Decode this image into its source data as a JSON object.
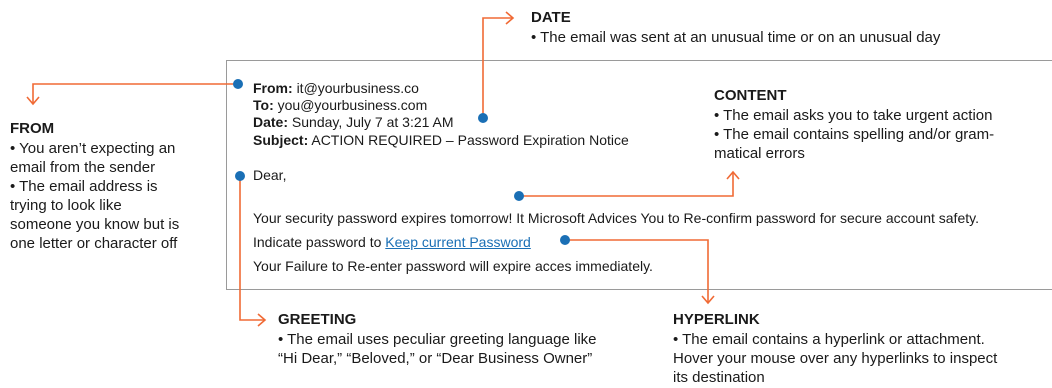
{
  "email": {
    "from_label": "From:",
    "from_value": "it@yourbusiness.co",
    "to_label": "To:",
    "to_value": "you@yourbusiness.com",
    "date_label": "Date:",
    "date_value": "Sunday, July 7 at 3:21 AM",
    "subject_label": "Subject:",
    "subject_value": "ACTION REQUIRED – Password Expiration Notice",
    "greeting": "Dear,",
    "line1": "Your security password expires tomorrow! It Microsoft Advices You to Re-confirm password for secure account safety.",
    "line2_prefix": "Indicate password to",
    "line2_link": "Keep current Password",
    "line3": "Your Failure to Re-enter password will expire acces immediately."
  },
  "callouts": {
    "date": {
      "title": "DATE",
      "bullets": [
        "• The email was sent at an unusual time or on an unusual day"
      ]
    },
    "from": {
      "title": "FROM",
      "lines": [
        "• You aren’t expecting an",
        "email from the sender",
        "• The email address is",
        "trying to look like",
        "someone you know but is",
        "one letter or character off"
      ]
    },
    "content": {
      "title": "CONTENT",
      "lines": [
        "• The email asks you to take urgent action",
        "• The email contains spelling and/or gram-",
        "matical errors"
      ]
    },
    "greeting": {
      "title": "GREETING",
      "lines": [
        "• The email uses peculiar greeting language like",
        "“Hi Dear,” “Beloved,” or “Dear Business Owner”"
      ]
    },
    "hyperlink": {
      "title": "HYPERLINK",
      "lines": [
        "• The email contains a hyperlink or attachment.",
        "Hover your mouse over any hyperlinks to inspect",
        "its destination"
      ]
    }
  },
  "colors": {
    "arrow": "#f06a35",
    "dot": "#1a6fb5",
    "link": "#1a6fb5",
    "border": "#9a9a9a"
  }
}
